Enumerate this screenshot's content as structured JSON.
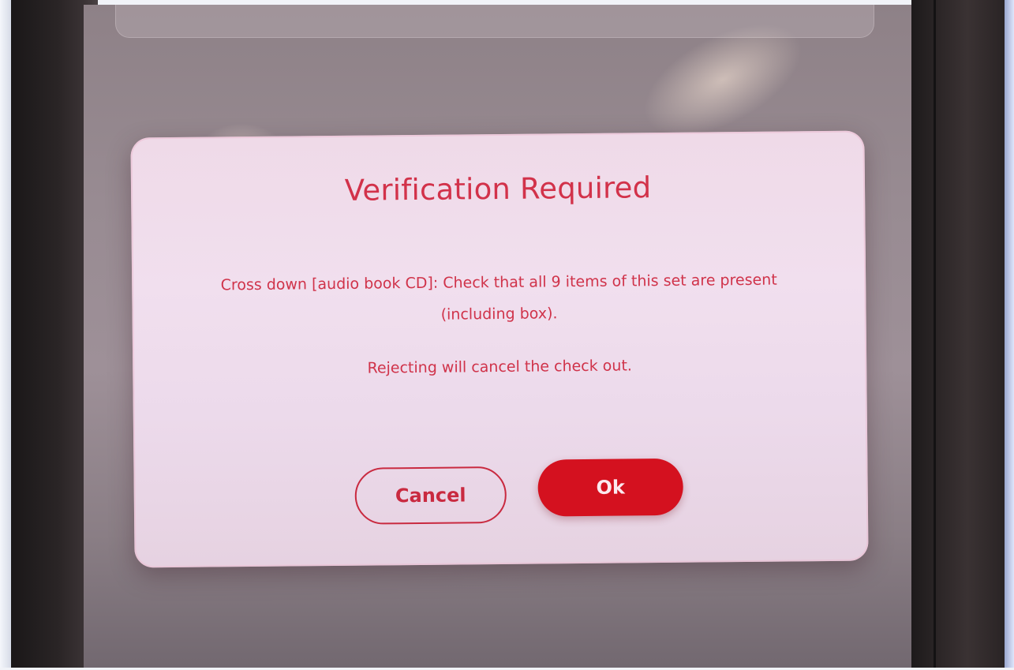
{
  "dialog": {
    "title": "Verification Required",
    "message": "Cross down [audio book CD]: Check that all 9 items of this set are present (including box).",
    "note": "Rejecting will cancel the check out.",
    "cancel_label": "Cancel",
    "ok_label": "Ok"
  },
  "colors": {
    "accent": "#d4111f",
    "text": "#d0334a",
    "dialog_background": "#efdae8"
  }
}
